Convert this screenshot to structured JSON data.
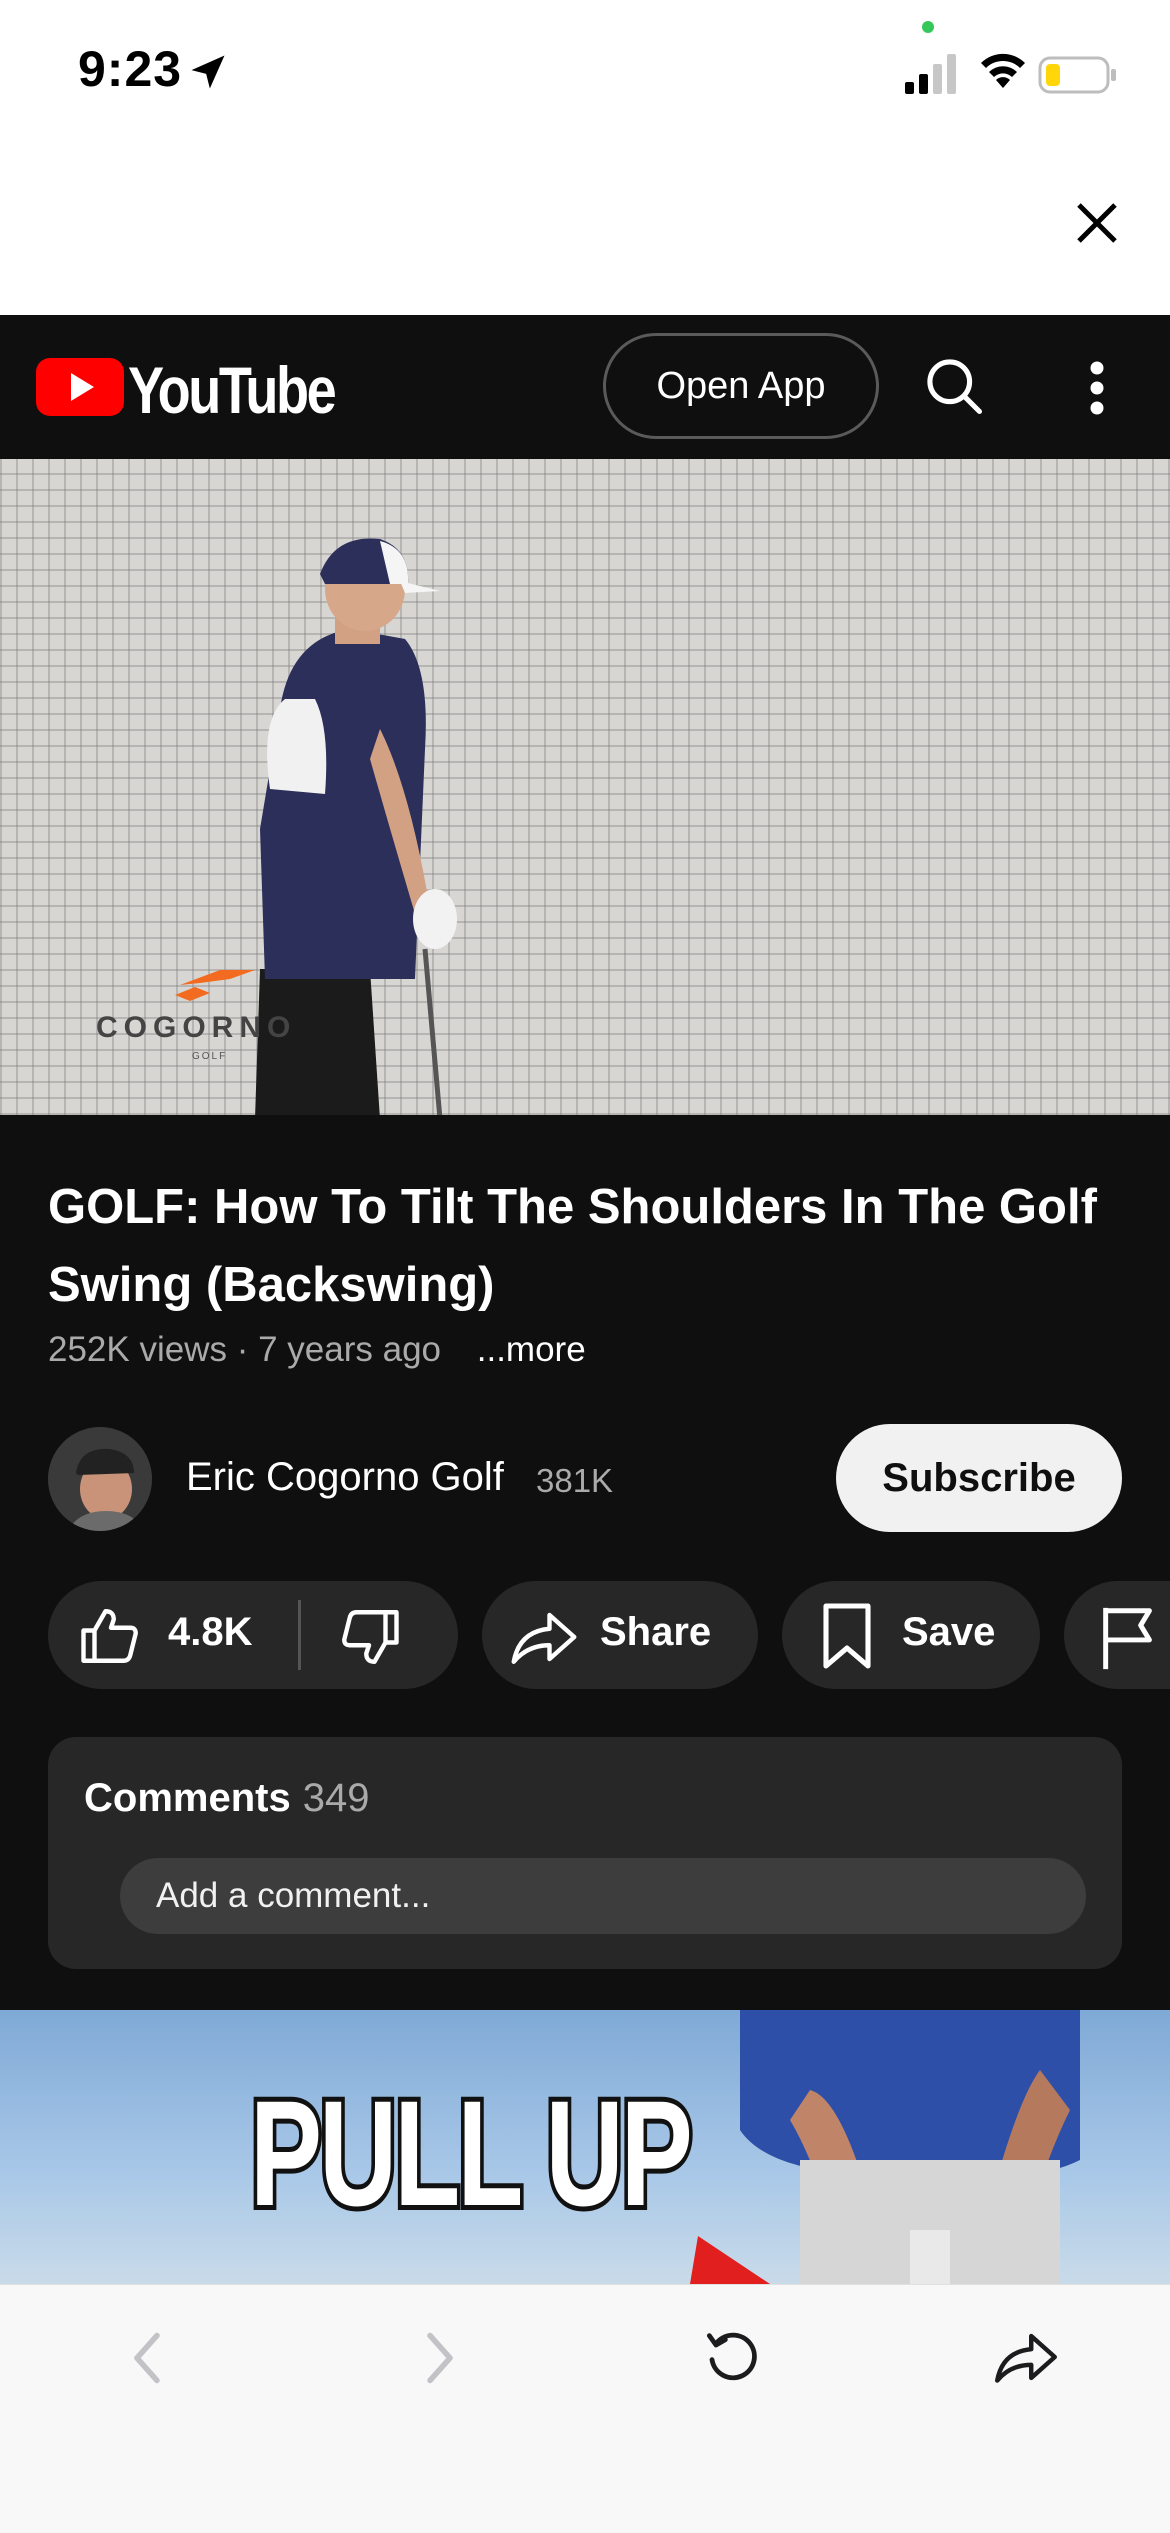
{
  "status_bar": {
    "time": "9:23"
  },
  "youtube": {
    "wordmark": "YouTube",
    "open_app_label": "Open App"
  },
  "video": {
    "watermark": "COGORNO",
    "watermark_sub": "GOLF",
    "title": "GOLF: How To Tilt The Shoulders In The Golf Swing (Backswing)",
    "views": "252K views",
    "separator": "·",
    "age": "7 years ago",
    "more_label": "...more"
  },
  "channel": {
    "name": "Eric Cogorno Golf",
    "subscribers": "381K",
    "subscribe_label": "Subscribe"
  },
  "actions": {
    "like_count": "4.8K",
    "share_label": "Share",
    "save_label": "Save"
  },
  "comments": {
    "label": "Comments",
    "count": "349",
    "placeholder": "Add a comment..."
  },
  "next_video": {
    "thumbnail_text": "PULL UP"
  },
  "colors": {
    "youtube_red": "#ff0000",
    "dark_bg": "#0f0f0f",
    "pill_bg": "#272727"
  }
}
